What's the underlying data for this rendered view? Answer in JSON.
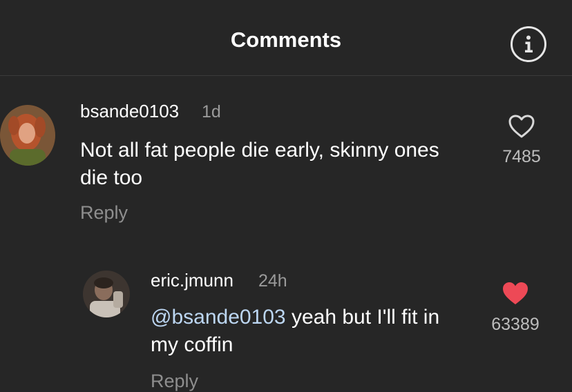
{
  "header": {
    "title": "Comments",
    "info_icon": "info-circle-icon"
  },
  "comments": [
    {
      "username": "bsande0103",
      "time": "1d",
      "text": "Not all fat people die early, skinny ones die too",
      "reply_label": "Reply",
      "likes": "7485",
      "liked": false,
      "like_icon": "heart-outline-icon"
    },
    {
      "username": "eric.jmunn",
      "time": "24h",
      "mention": "@bsande0103",
      "text": " yeah but I'll fit in my coffin",
      "reply_label": "Reply",
      "likes": "63389",
      "liked": true,
      "like_icon": "heart-filled-icon"
    }
  ],
  "colors": {
    "background": "#262626",
    "liked_heart": "#ed4956",
    "mention": "#bcd6f2",
    "secondary_text": "#8e8e8e"
  }
}
